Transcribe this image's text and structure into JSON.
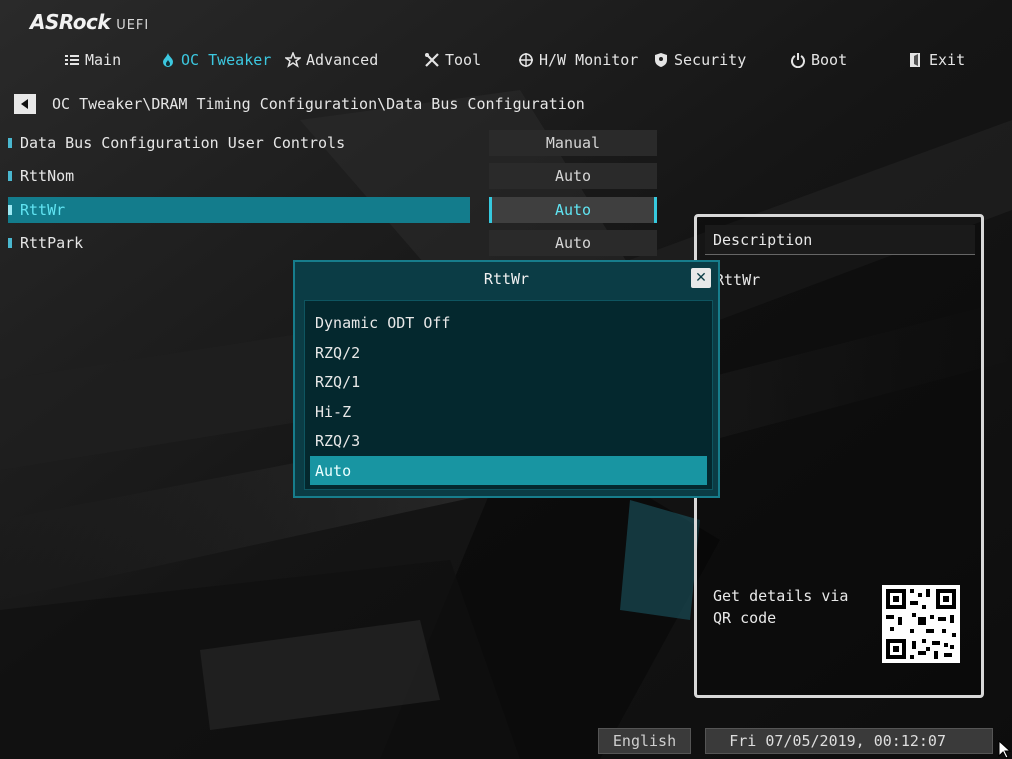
{
  "brand": {
    "name": "ASRock",
    "product": "UEFI"
  },
  "nav": [
    {
      "label": "Main",
      "icon": "list-icon",
      "active": false
    },
    {
      "label": "OC Tweaker",
      "icon": "flame-icon",
      "active": true
    },
    {
      "label": "Advanced",
      "icon": "star-icon",
      "active": false
    },
    {
      "label": "Tool",
      "icon": "tools-icon",
      "active": false
    },
    {
      "label": "H/W Monitor",
      "icon": "crosshair-icon",
      "active": false
    },
    {
      "label": "Security",
      "icon": "shield-icon",
      "active": false
    },
    {
      "label": "Boot",
      "icon": "power-icon",
      "active": false
    },
    {
      "label": "Exit",
      "icon": "exit-icon",
      "active": false
    }
  ],
  "breadcrumb": "OC Tweaker\\DRAM Timing Configuration\\Data Bus Configuration",
  "settings": [
    {
      "label": "Data Bus Configuration User Controls",
      "value": "Manual",
      "selected": false
    },
    {
      "label": "RttNom",
      "value": "Auto",
      "selected": false
    },
    {
      "label": "RttWr",
      "value": "Auto",
      "selected": true
    },
    {
      "label": "RttPark",
      "value": "Auto",
      "selected": false
    }
  ],
  "description": {
    "title": "Description",
    "text": "RttWr",
    "qr_label": "Get details via QR code"
  },
  "popup": {
    "title": "RttWr",
    "options": [
      "Dynamic ODT Off",
      "RZQ/2",
      "RZQ/1",
      "Hi-Z",
      "RZQ/3",
      "Auto"
    ],
    "selected": "Auto"
  },
  "footer": {
    "language": "English",
    "datetime": "Fri 07/05/2019, 00:12:07"
  },
  "colors": {
    "accent": "#3cc8e0",
    "selection": "#137c8c",
    "popup_bg": "#0b3c45",
    "popup_selected": "#1895a2"
  }
}
